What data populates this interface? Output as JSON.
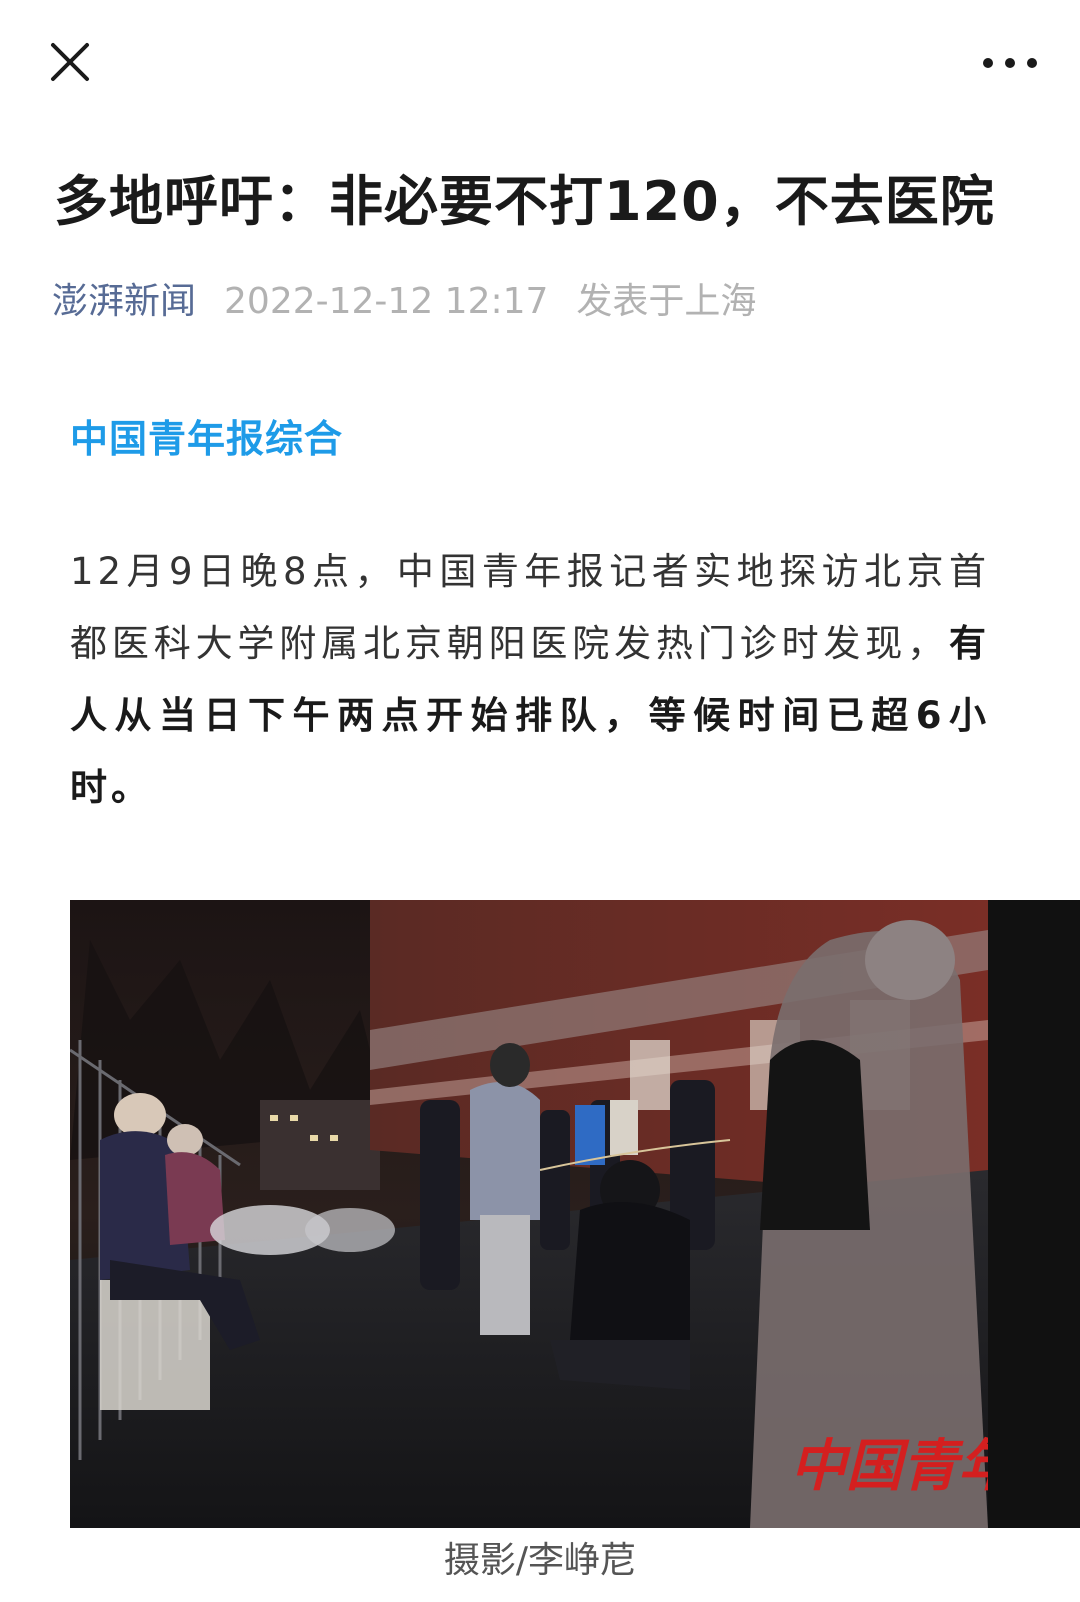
{
  "topbar": {
    "close_icon": "close-icon",
    "more_icon": "more-horizontal-icon"
  },
  "article": {
    "title": "多地呼吁：非必要不打120，不去医院",
    "source": "澎湃新闻",
    "datetime": "2022-12-12 12:17",
    "location": "发表于上海",
    "section_head": "中国青年报综合",
    "paragraph_normal": "12月9日晚8点，中国青年报记者实地探访北京首都医科大学附属北京朝阳医院发热门诊时发现，",
    "paragraph_bold": "有人从当日下午两点开始排队，等候时间已超6小时。",
    "photo_watermark": "中国青年报",
    "photo_caption": "摄影/李峥苨"
  },
  "colors": {
    "source_link": "#576b95",
    "section_head": "#1e9be8",
    "meta_grey": "#b2b2b2"
  }
}
